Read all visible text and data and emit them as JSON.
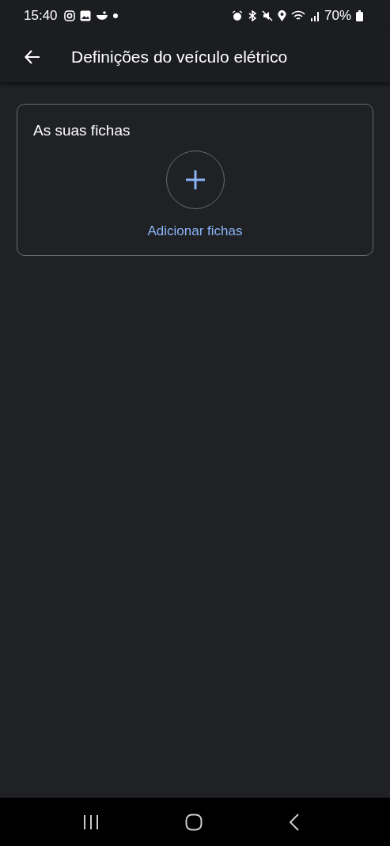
{
  "status_bar": {
    "time": "15:40",
    "battery": "70%"
  },
  "app_bar": {
    "title": "Definições do veículo elétrico"
  },
  "card": {
    "title": "As suas fichas",
    "add_label": "Adicionar fichas"
  }
}
